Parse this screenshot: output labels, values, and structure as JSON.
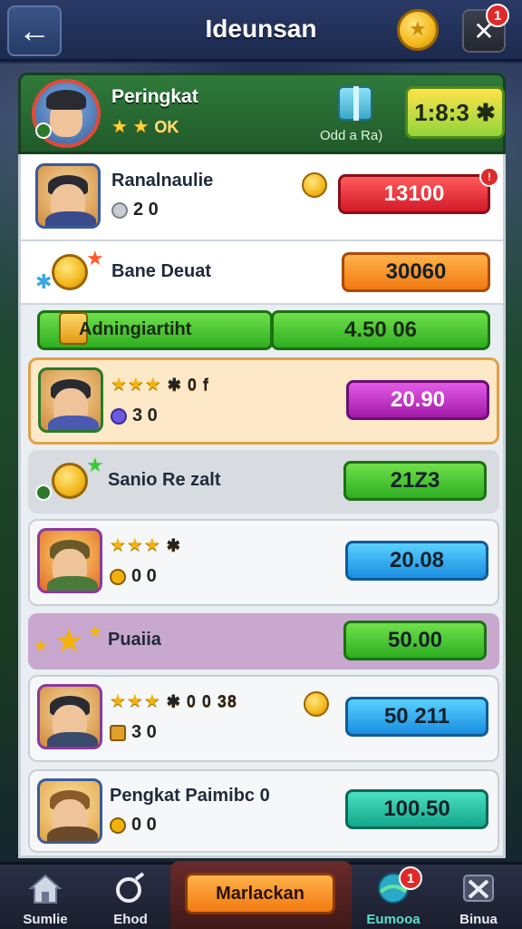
{
  "header": {
    "title": "Ideunsan",
    "tools_badge": "1"
  },
  "profile": {
    "title": "Peringkat",
    "stars": "★ ★",
    "stars_sub": "OK",
    "gift_label": "Odd a Ra)",
    "score": "1:8:3 ✱"
  },
  "rows": [
    {
      "name": "Ranalnaulie",
      "stat": "2 0",
      "value": "13100"
    },
    {
      "name": "Bane Deuat",
      "value": "30060"
    },
    {
      "name": "Adningiartiht",
      "value": "4.50 06"
    },
    {
      "stars": "★★★",
      "stars_extra": "✱ 0 f",
      "stat": "3 0",
      "value": "20.90"
    },
    {
      "name": "Sanio Re zalt",
      "value": "21Z3"
    },
    {
      "stars": "★★★",
      "stars_extra": "✱",
      "stat": "0 0",
      "value": "20.08"
    },
    {
      "name": "Puaiia",
      "value": "50.00"
    },
    {
      "stars": "★★★",
      "stars_extra": "✱ 0 0 38",
      "stat": "3 0",
      "value": "50 211"
    },
    {
      "name": "Pengkat Paimibc 0",
      "stat": "0 0",
      "value": "100.50"
    }
  ],
  "bottom_nav": {
    "home": "Sumlie",
    "ehod": "Ehod",
    "cta": "Marlackan",
    "eumooa": "Eumooa",
    "eumooa_badge": "1",
    "binua": "Binua"
  }
}
